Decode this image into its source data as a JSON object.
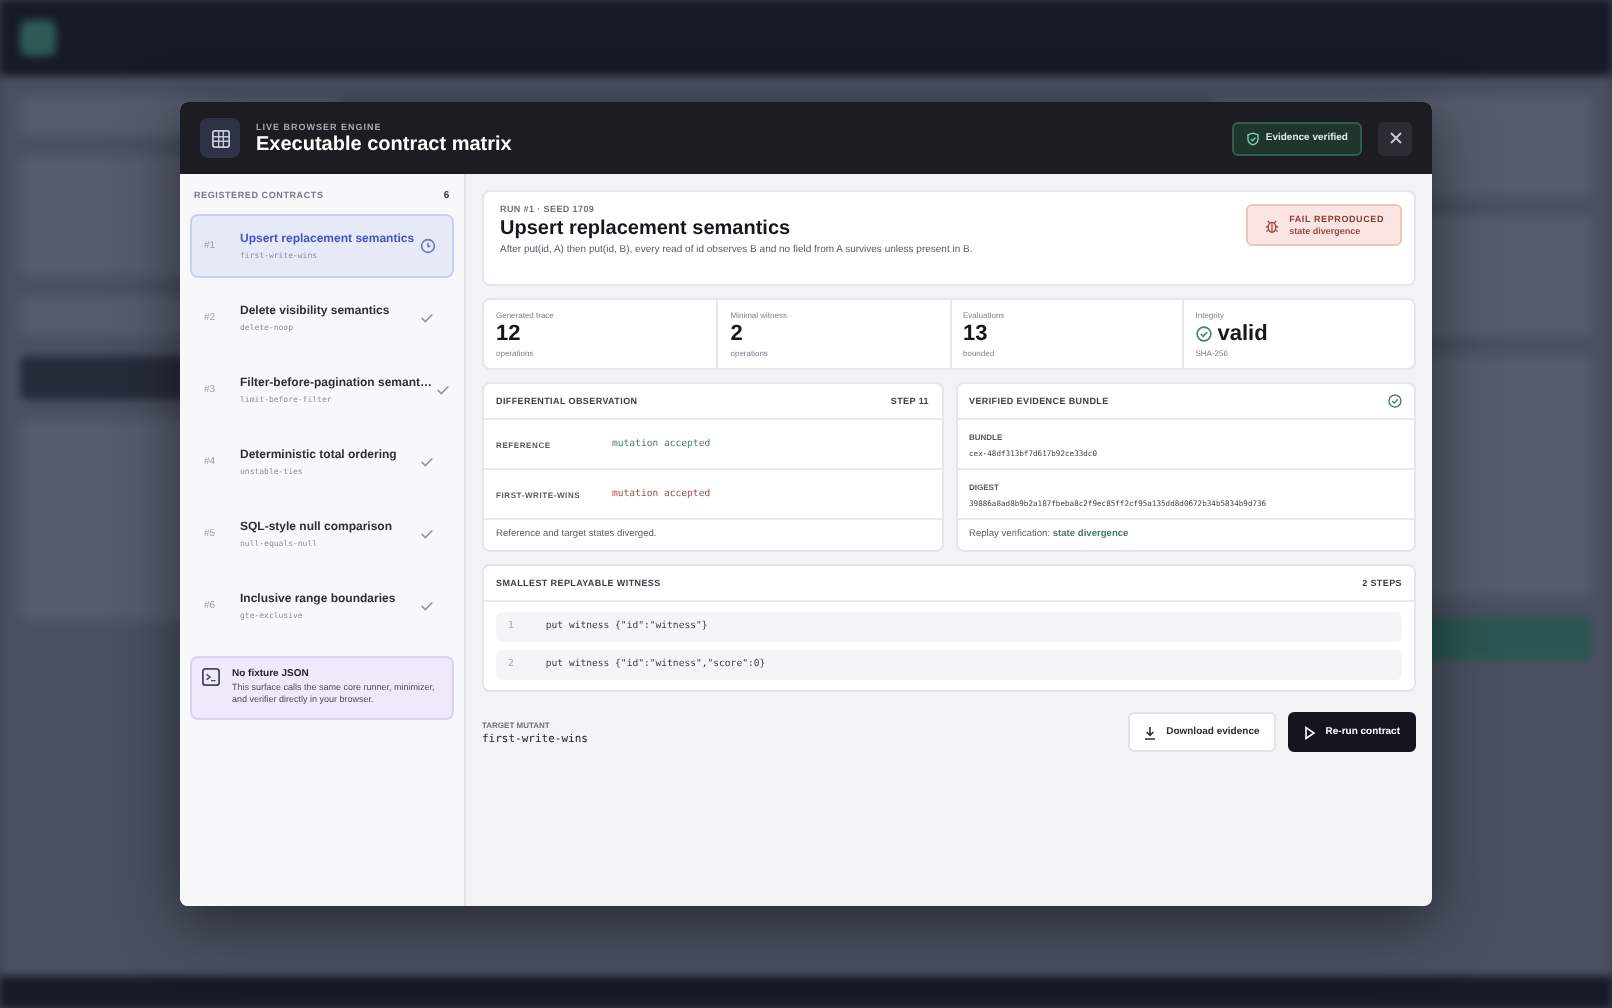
{
  "modal": {
    "eyebrow": "LIVE BROWSER ENGINE",
    "title": "Executable contract matrix",
    "badge": "Evidence verified"
  },
  "contracts": {
    "heading": "REGISTERED CONTRACTS",
    "count": "6",
    "items": [
      {
        "number": "#1",
        "title": "Upsert replacement semantics",
        "slug": "first-write-wins",
        "selected": true,
        "kind": "active"
      },
      {
        "number": "#2",
        "title": "Delete visibility semantics",
        "slug": "delete-noop",
        "selected": false,
        "kind": "passed"
      },
      {
        "number": "#3",
        "title": "Filter-before-pagination semant…",
        "slug": "limit-before-filter",
        "selected": false,
        "kind": "passed"
      },
      {
        "number": "#4",
        "title": "Deterministic total ordering",
        "slug": "unstable-ties",
        "selected": false,
        "kind": "passed"
      },
      {
        "number": "#5",
        "title": "SQL-style null comparison",
        "slug": "null-equals-null",
        "selected": false,
        "kind": "passed"
      },
      {
        "number": "#6",
        "title": "Inclusive range boundaries",
        "slug": "gte-exclusive",
        "selected": false,
        "kind": "passed"
      }
    ]
  },
  "note": {
    "title": "No fixture JSON",
    "text": "This surface calls the same core runner, minimizer, and verifier directly in your browser."
  },
  "run": {
    "meta": "RUN #1 · SEED 1709",
    "title": "Upsert replacement semantics",
    "description": "After put(id, A) then put(id, B), every read of id observes B and no field from A survives unless present in B.",
    "status": "FAIL REPRODUCED",
    "status_detail": "state divergence"
  },
  "stats": [
    {
      "kind": "number",
      "label": "Generated trace",
      "value": "12",
      "unit": "operations"
    },
    {
      "kind": "number",
      "label": "Minimal witness",
      "value": "2",
      "unit": "operations"
    },
    {
      "kind": "number",
      "label": "Evaluations",
      "value": "13",
      "unit": "bounded"
    },
    {
      "kind": "check",
      "label": "Integrity",
      "value": "valid",
      "unit": "SHA-256"
    }
  ],
  "differential": {
    "title": "DIFFERENTIAL OBSERVATION",
    "step": "STEP 11",
    "rows": [
      {
        "label": "REFERENCE",
        "value": "mutation accepted",
        "kind": "match"
      },
      {
        "label": "FIRST-WRITE-WINS",
        "value": "mutation accepted",
        "kind": "diverged"
      }
    ],
    "summary": "Reference and target states diverged."
  },
  "bundle": {
    "title": "VERIFIED EVIDENCE BUNDLE",
    "fields": [
      {
        "label": "BUNDLE",
        "value": "cex-48df313bf7d617b92ce33dc0"
      },
      {
        "label": "DIGEST",
        "value": "39886a8ad8b9b2a187fbeba8c2f9ec85ff2cf95a135dd8d0672b34b5834b9d736"
      }
    ],
    "replay_label": "Replay verification:",
    "replay_value": "state divergence"
  },
  "witness": {
    "title": "SMALLEST REPLAYABLE WITNESS",
    "steps": "2 STEPS",
    "lines": [
      {
        "number": "1",
        "code": "put witness {\"id\":\"witness\"}"
      },
      {
        "number": "2",
        "code": "put witness {\"id\":\"witness\",\"score\":0}"
      }
    ]
  },
  "target": {
    "label": "TARGET MUTANT",
    "value": "first-write-wins"
  },
  "buttons": [
    {
      "kind": "secondary",
      "label": "Download evidence"
    },
    {
      "kind": "primary",
      "label": "Re-run contract"
    }
  ]
}
